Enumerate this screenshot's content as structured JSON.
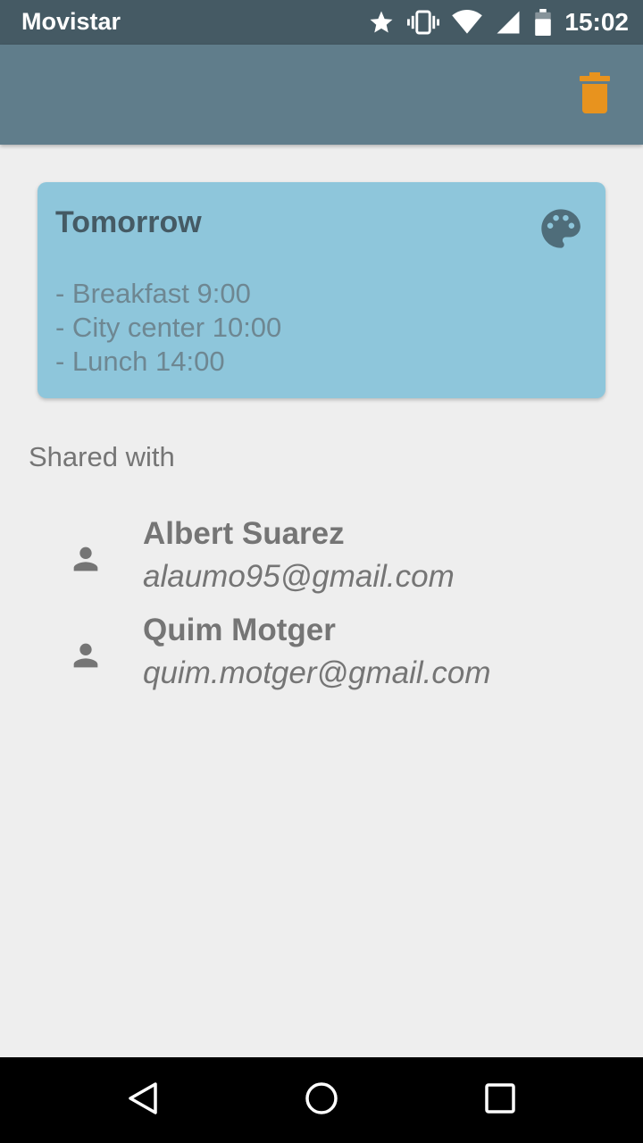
{
  "status_bar": {
    "carrier": "Movistar",
    "time": "15:02",
    "icons": [
      "star-icon",
      "vibrate-icon",
      "wifi-icon",
      "signal-icon",
      "battery-icon"
    ]
  },
  "app_bar": {
    "delete_icon": "trash-icon",
    "delete_color": "#e8931e"
  },
  "note": {
    "title": "Tomorrow",
    "lines": [
      "- Breakfast 9:00",
      "- City center 10:00",
      "- Lunch 14:00"
    ],
    "color": "#8ec6db",
    "palette_icon": "palette-icon"
  },
  "shared": {
    "title": "Shared with",
    "users": [
      {
        "name": "Albert Suarez",
        "email": "alaumo95@gmail.com",
        "icon": "person-icon"
      },
      {
        "name": "Quim Motger",
        "email": "quim.motger@gmail.com",
        "icon": "person-icon"
      }
    ]
  },
  "nav_bar": {
    "buttons": [
      "back-icon",
      "home-icon",
      "recents-icon"
    ]
  }
}
